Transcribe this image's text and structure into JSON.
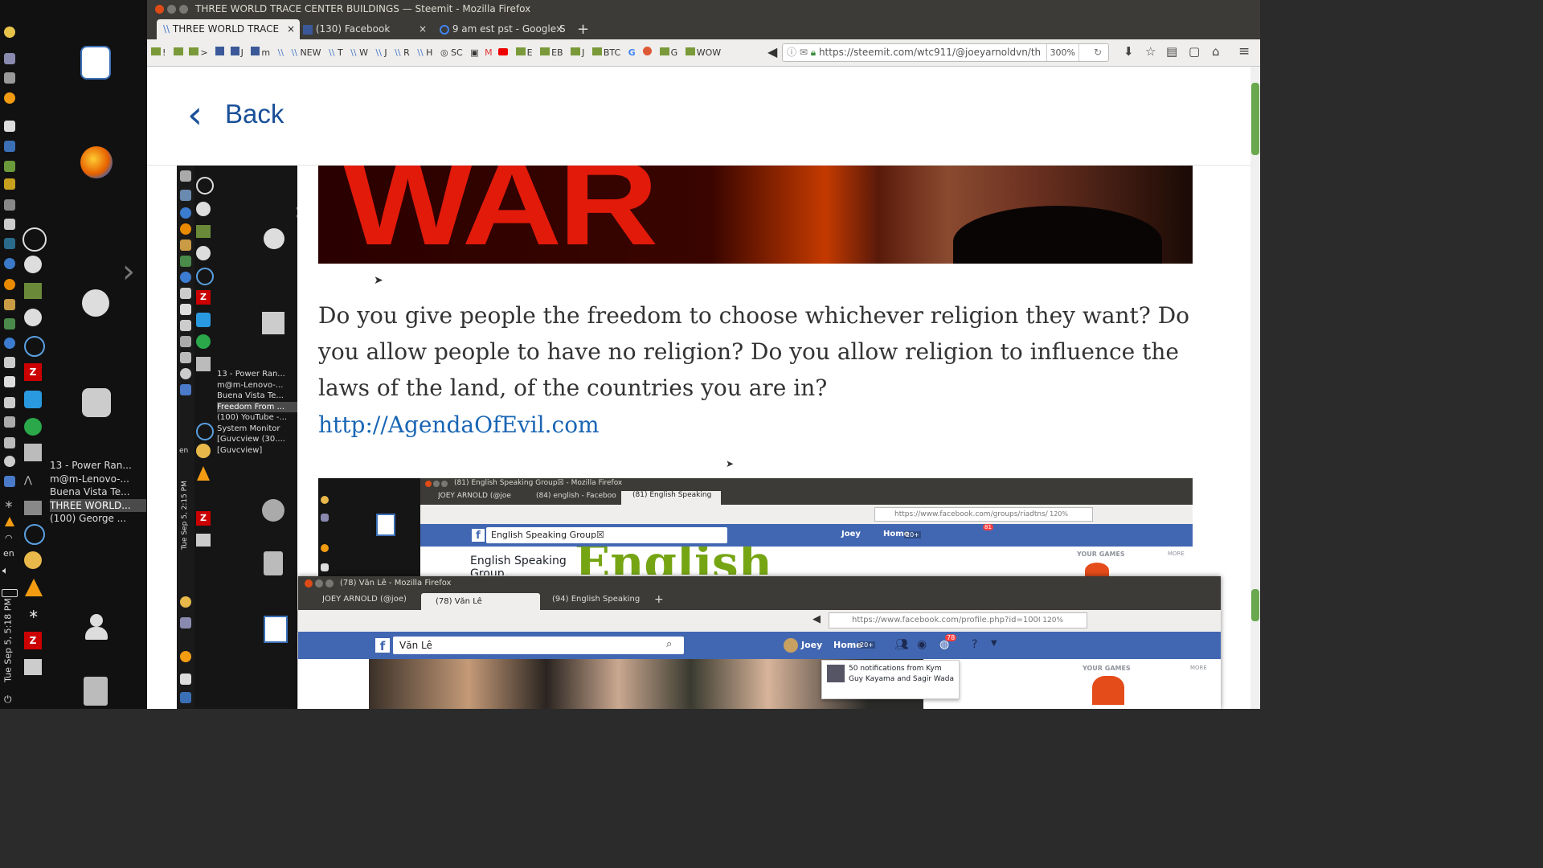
{
  "launcher": {
    "window_list": [
      "13 - Power Ran...",
      "m@m-Lenovo-...",
      "Buena Vista Te...",
      "THREE WORLD...",
      "(100) George ..."
    ],
    "selected_index": 3,
    "clock": "Tue Sep 5, 5:18 PM",
    "lang": "en"
  },
  "browser": {
    "title": "THREE WORLD TRACE CENTER BUILDINGS — Steemit - Mozilla Firefox",
    "tabs": [
      "THREE WORLD TRACE",
      "(130) Facebook",
      "9 am est pst - Google S"
    ],
    "bookmarks": [
      "!",
      ">",
      "J",
      "m",
      "NEW",
      "T",
      "W",
      "J",
      "R",
      "H",
      "SC",
      "E",
      "EB",
      "J",
      "BTC",
      "G",
      "G",
      "WOW"
    ],
    "url": "https://steemit.com/wtc911/@joeyarnoldvn/th",
    "zoom": "300%"
  },
  "page": {
    "back_label": "Back",
    "banner_text": "WAR",
    "paragraph": "Do you give people the freedom to choose whichever religion they want? Do you allow people to have no religion? Do you allow religion to influence the laws of the land, of the countries you are in?",
    "link": "http://AgendaOfEvil.com"
  },
  "inner_screen": {
    "window_list": [
      "13 - Power Ran...",
      "m@m-Lenovo-...",
      "Buena Vista Te...",
      "Freedom From ...",
      "(100) YouTube -...",
      "System Monitor",
      "[Guvcview (30....",
      "[Guvcview]"
    ],
    "selected_index": 3,
    "clock": "Tue Sep 5, 2:15 PM",
    "lang": "en"
  },
  "fb_window_1": {
    "title": "(81) English Speaking Group☒ - Mozilla Firefox",
    "tabs": [
      "JOEY ARNOLD (@joe",
      "(84) english - Faceboo",
      "(81) English Speaking"
    ],
    "url": "https://www.facebook.com/groups/riadtns/",
    "zoom": "120%",
    "search_value": "English Speaking Group☒",
    "user": "Joey",
    "home": "Home",
    "home_badge": "20+",
    "notif_badge": "81",
    "group_name": "English Speaking",
    "group_name_2": "Group",
    "cover_text": "English",
    "your_games": "YOUR GAMES",
    "more": "MORE"
  },
  "fb_window_2": {
    "title": "(78) Văn Lê - Mozilla Firefox",
    "tabs": [
      "JOEY ARNOLD (@joe)",
      "(78) Văn Lê",
      "(94) English Speaking"
    ],
    "url": "https://www.facebook.com/profile.php?id=1000",
    "zoom": "120%",
    "search_value": "Văn Lê",
    "user": "Joey",
    "home": "Home",
    "home_badge": "20+",
    "notif_badge": "78",
    "notification": "50 notifications from Kym Guy Kayama and Sagir Wada",
    "your_games": "YOUR GAMES",
    "more": "MORE"
  }
}
